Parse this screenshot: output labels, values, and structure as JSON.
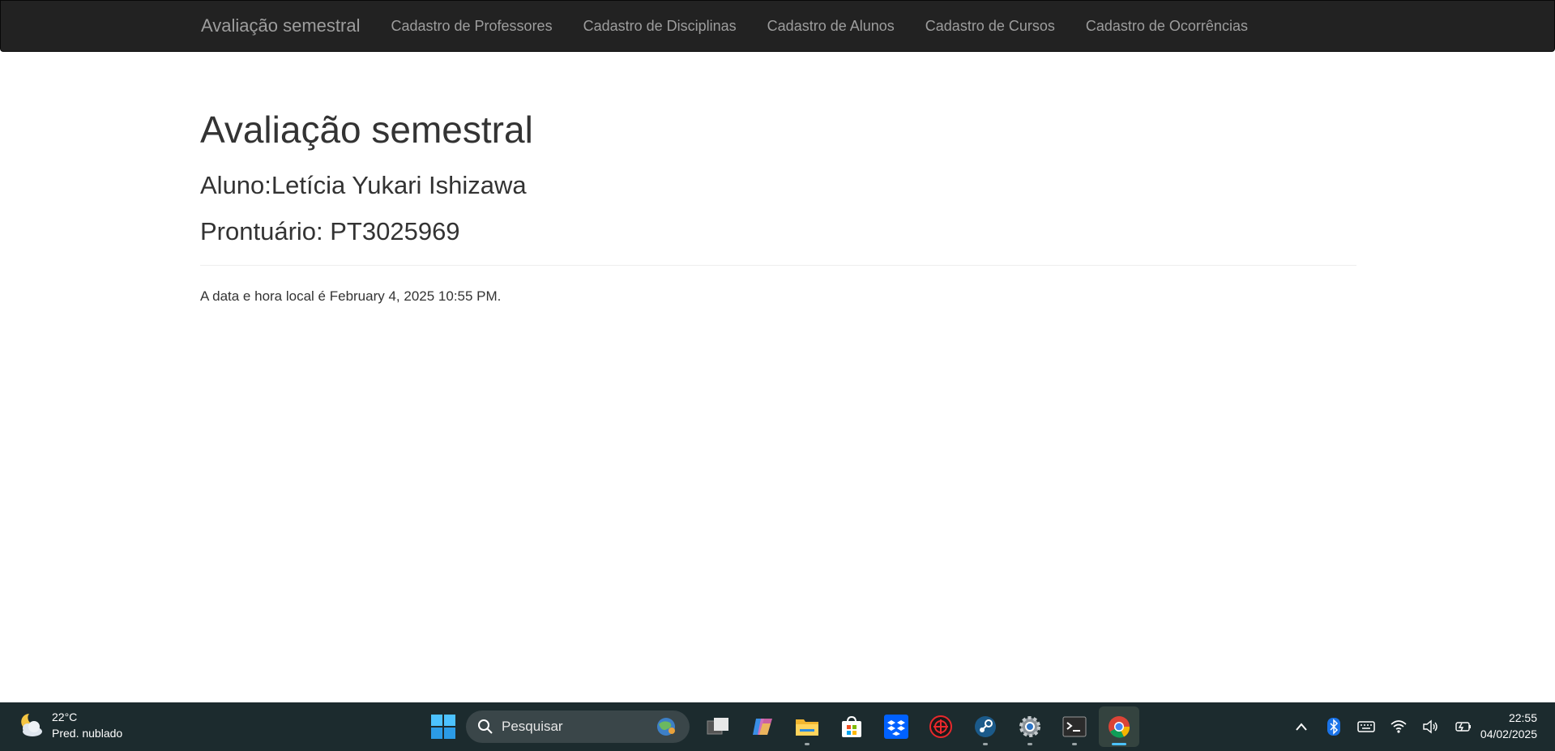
{
  "navbar": {
    "brand": "Avaliação semestral",
    "links": [
      "Cadastro de Professores",
      "Cadastro de Disciplinas",
      "Cadastro de Alunos",
      "Cadastro de Cursos",
      "Cadastro de Ocorrências"
    ]
  },
  "main": {
    "title": "Avaliação semestral",
    "student": "Aluno:Letícia Yukari Ishizawa",
    "record": "Prontuário: PT3025969",
    "datetime": "A data e hora local é February 4, 2025 10:55 PM."
  },
  "taskbar": {
    "weather": {
      "temp": "22°C",
      "condition": "Pred. nublado",
      "icon": "partly-cloudy-night-icon"
    },
    "search_placeholder": "Pesquisar",
    "apps": [
      "task-view-icon",
      "copilot-icon",
      "file-explorer-icon",
      "microsoft-store-icon",
      "dropbox-icon",
      "game-launcher-icon",
      "steam-icon",
      "settings-icon",
      "terminal-icon",
      "chrome-icon"
    ],
    "clock": {
      "time": "22:55",
      "date": "04/02/2025"
    }
  },
  "colors": {
    "navbar_bg": "#222222",
    "navbar_text": "#9d9d9d",
    "taskbar_bg": "#1c2b2e",
    "accent": "#4cc2ff"
  }
}
